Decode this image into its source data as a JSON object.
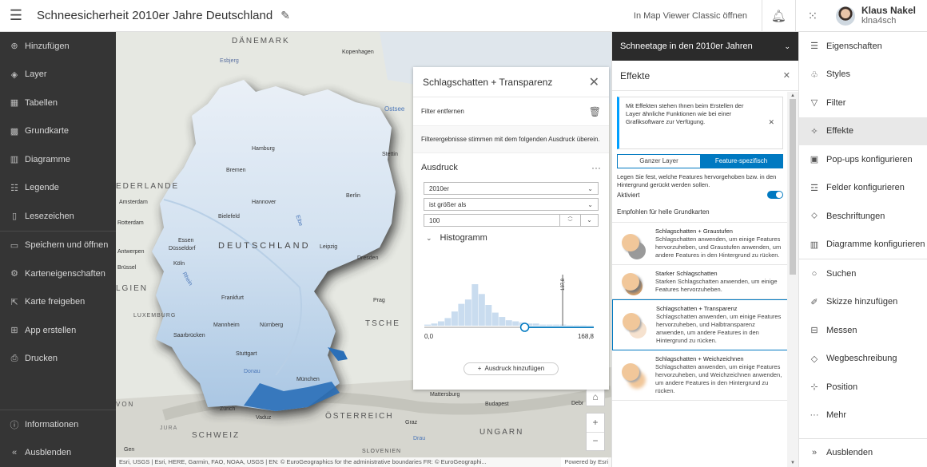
{
  "header": {
    "title": "Schneesicherheit 2010er Jahre Deutschland",
    "classic_link": "In Map Viewer Classic öffnen",
    "user_name": "Klaus Nakel",
    "user_login": "klna4sch"
  },
  "left_nav": {
    "items": [
      {
        "label": "Hinzufügen",
        "icon": "plus-circle-icon"
      },
      {
        "label": "Layer",
        "icon": "layers-icon"
      },
      {
        "label": "Tabellen",
        "icon": "table-icon"
      },
      {
        "label": "Grundkarte",
        "icon": "basemap-icon"
      },
      {
        "label": "Diagramme",
        "icon": "chart-icon"
      },
      {
        "label": "Legende",
        "icon": "legend-icon"
      },
      {
        "label": "Lesezeichen",
        "icon": "bookmark-icon"
      },
      {
        "label": "Speichern und öffnen",
        "icon": "folder-icon"
      },
      {
        "label": "Karteneigenschaften",
        "icon": "gear-icon"
      },
      {
        "label": "Karte freigeben",
        "icon": "share-icon"
      },
      {
        "label": "App erstellen",
        "icon": "apps-icon"
      },
      {
        "label": "Drucken",
        "icon": "print-icon"
      }
    ],
    "bottom": [
      {
        "label": "Informationen",
        "icon": "info-icon"
      },
      {
        "label": "Ausblenden",
        "icon": "collapse-icon"
      }
    ]
  },
  "map": {
    "countries": {
      "denmark": "DÄNEMARK",
      "germany": "DEUTSCHLAND",
      "netherlands": "EDERLANDE",
      "belgium": "LGIEN",
      "luxembourg": "LUXEMBURG",
      "czech": "TSCHE",
      "austria": "ÖSTERREICH",
      "hungary": "UNGARN",
      "switzerland": "SCHWEIZ",
      "slovenia": "SLOVENIEN",
      "von": "VON",
      "ostsee": "Ostsee",
      "jura": "JURA",
      "drau": "Drau"
    },
    "cities": [
      "Esbjerg",
      "Kopenhagen",
      "Hamburg",
      "Bremen",
      "Stettin",
      "Berlin",
      "Hannover",
      "Amsterdam",
      "Bielefeld",
      "Rotterdam",
      "Essen",
      "Düsseldorf",
      "Leipzig",
      "Dresden",
      "Köln",
      "Antwerpen",
      "Frankfurt",
      "Prag",
      "Mannheim",
      "Nürnberg",
      "Saarbrücken",
      "Stuttgart",
      "München",
      "Mattersburg",
      "Budapest",
      "Debr",
      "Zürich",
      "Vaduz",
      "Graz",
      "Gen",
      "Brüssel"
    ],
    "rivers": {
      "elbe": "Elbe",
      "rhein": "Rhein",
      "donau": "Donau"
    },
    "attribution": "Esri, USGS | Esri, HERE, Garmin, FAO, NOAA, USGS | EN: © EuroGeographics for the administrative boundaries FR: © EuroGeographi...",
    "powered": "Powered by Esri"
  },
  "filter_panel": {
    "title": "Schlagschatten + Transparenz",
    "remove_filter": "Filter entfernen",
    "note": "Filterergebnisse stimmen mit dem folgenden Ausdruck überein.",
    "expression_label": "Ausdruck",
    "field": "2010er",
    "operator": "ist größer als",
    "value": "100",
    "histogram_label": "Histogramm",
    "histogram_mean": "137,8",
    "histogram_min": "0,0",
    "histogram_max": "168,8",
    "histogram_bins": [
      1,
      2,
      4,
      7,
      13,
      20,
      24,
      38,
      29,
      19,
      12,
      8,
      5,
      4,
      3,
      2,
      2,
      1,
      1,
      1,
      1,
      0.5,
      0.5,
      0.5,
      0.3
    ],
    "add_expression": "Ausdruck hinzufügen"
  },
  "effects_panel": {
    "layer_dropdown": "Schneetage in den 2010er Jahren",
    "title": "Effekte",
    "info": "Mit Effekten stehen Ihnen beim Erstellen der Layer ähnliche Funktionen wie bei einer Grafiksoftware zur Verfügung.",
    "tab_whole": "Ganzer Layer",
    "tab_feature": "Feature-spezifisch",
    "description": "Legen Sie fest, welche Features hervorgehoben bzw. in den Hintergrund gerückt werden sollen.",
    "enabled_label": "Aktiviert",
    "recommended": "Empfohlen für helle Grundkarten",
    "cards": [
      {
        "title": "Schlagschatten + Graustufen",
        "text": "Schlagschatten anwenden, um einige Features hervorzuheben, und Graustufen anwenden, um andere Features in den Hintergrund zu rücken."
      },
      {
        "title": "Starker Schlagschatten",
        "text": "Starken Schlagschatten anwenden, um einige Features hervorzuheben."
      },
      {
        "title": "Schlagschatten + Transparenz",
        "text": "Schlagschatten anwenden, um einige Features hervorzuheben, und Halbtransparenz anwenden, um andere Features in den Hintergrund zu rücken."
      },
      {
        "title": "Schlagschatten + Weichzeichnen",
        "text": "Schlagschatten anwenden, um einige Features hervorzuheben, und Weichzeichnen anwenden, um andere Features in den Hintergrund zu rücken."
      }
    ]
  },
  "right_nav": {
    "items": [
      {
        "label": "Eigenschaften",
        "icon": "sliders-icon"
      },
      {
        "label": "Styles",
        "icon": "styles-icon"
      },
      {
        "label": "Filter",
        "icon": "filter-icon"
      },
      {
        "label": "Effekte",
        "icon": "effects-icon"
      },
      {
        "label": "Pop-ups konfigurieren",
        "icon": "popup-icon"
      },
      {
        "label": "Felder konfigurieren",
        "icon": "fields-icon"
      },
      {
        "label": "Beschriftungen",
        "icon": "label-icon"
      },
      {
        "label": "Diagramme konfigurieren",
        "icon": "chart-config-icon"
      },
      {
        "label": "Suchen",
        "icon": "search-icon"
      },
      {
        "label": "Skizze hinzufügen",
        "icon": "sketch-icon"
      },
      {
        "label": "Messen",
        "icon": "measure-icon"
      },
      {
        "label": "Wegbeschreibung",
        "icon": "directions-icon"
      },
      {
        "label": "Position",
        "icon": "location-icon"
      },
      {
        "label": "Mehr",
        "icon": "more-icon"
      }
    ],
    "collapse": "Ausblenden"
  },
  "colors": {
    "accent": "#0079c1",
    "nav_dark": "#353535",
    "snow_light": "#dce8f4",
    "snow_dark": "#1f5fa8"
  }
}
